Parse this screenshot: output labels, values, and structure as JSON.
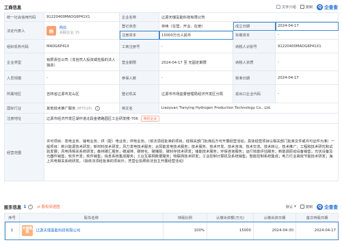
{
  "biz": {
    "title": "工商信息",
    "tools": {
      "text_intro": "文字介绍",
      "copy": "复制",
      "brand": "企查查"
    },
    "rows": [
      {
        "l1": "统一社会信用代码",
        "v1": "91220400MADG6P41X1",
        "l2": "企业名称",
        "v2": "辽源天瑞氢能科技有限公司"
      },
      {
        "l1": "法定代表人",
        "rep_avatar": "杨",
        "rep_name": "杨炫",
        "rep_tag": "关联企业 15",
        "l2": "登记状态",
        "status": "存续（在营、开业、在册）",
        "l3": "成立日期",
        "v3": "2024-04-17"
      },
      {
        "l2": "注册资本",
        "v2": "15000万元人民币",
        "l3": "实缴资本",
        "v3": "-"
      },
      {
        "l1": "组织机构代码",
        "v1": "MADG6P41X",
        "l2": "工商注册号",
        "v2": "-",
        "l3": "纳税人识别号",
        "v3": "91220400MADG6P41X1"
      },
      {
        "l1": "企业类型",
        "v1": "有限责任公司（非自然人投资或控股的法人独资）",
        "l2": "营业期限",
        "v2": "2024-04-17 至 无固定期限",
        "l3": "纳税人资质",
        "v3": "-"
      },
      {
        "l1": "人员规模",
        "v1": "-",
        "l2": "参保人数",
        "v2": "-",
        "l3": "核准日期",
        "v3": "2024-04-17"
      },
      {
        "l1": "所属地区",
        "v1": "吉林省辽源市龙山区",
        "l2": "登记机关",
        "v2": "辽源市市场监督管理局经济开发区分局",
        "l3": "进出口企业代码",
        "v3": "-"
      },
      {
        "l1": "国标行业",
        "v1": "其他技术推广服务",
        "v1_code": "(M7519)",
        "l2": "英文名",
        "v2": "Liaoyuan Tianying Hydrogen Production Technology Co., Ltd."
      },
      {
        "l1": "注册地址",
        "v1": "辽源市经济开发区湖中道北段金德路园区工业研发楼-706",
        "nearby": "附近企业"
      },
      {
        "l1": "经营范围",
        "v1": "许可项目：发电业务、输电业务、供（配）电业务；供电业务。（依法须经批准的项目，经相关部门批准后方可开展经营活动，具体经营项目以相关部门批准文件或许可证件为准）一般项目：新兴能源技术研发；新材料技术研发；风力发电技术服务；太阳能发电技术服务；技术服务、技术开发、技术咨询、技术交流、技术转让、技术推广；工程和技术研究和试验发展；风电场相关系统研发；森林碳汇服务；碳减排、碳转化、碳捕捉、碳封存技术研发；储能技术服务；环保咨询服务；运行效能评估服务；新能源原动设备销售；光伏设备及元器件销售；软件开发；软件销售；信息系统集成服务；工业互联网数据服务；物联网技术研发；工业控制计算机及系统销售；智能控制系统集成；电力行业高效节能技术研发；海上风电相关系统研发。（除依法须经批准的项目外，凭营业执照依法自主开展经营活动）"
      }
    ]
  },
  "shareholders": {
    "title": "股东信息",
    "count": "1",
    "equity_chart": "股权穿透图",
    "sort": "默认",
    "tools": {
      "copy": "复制",
      "brand": "企查查"
    },
    "headers": [
      "序号",
      "股东名称",
      "持股比例",
      "认缴出资额(万元)",
      "认缴出资日期",
      "首次持股日期"
    ],
    "rows": [
      {
        "idx": "1",
        "logo": "天瑞氢能",
        "name": "辽源天瑞氢能科技有限公司",
        "ratio": "100%",
        "amount": "15000",
        "date": "2024-04-30",
        "first": "2024-04-17"
      }
    ]
  },
  "colors": {
    "accent": "#1f6fe0",
    "highlight": "#3a8ad6",
    "label_bg": "#f2f6fb"
  }
}
